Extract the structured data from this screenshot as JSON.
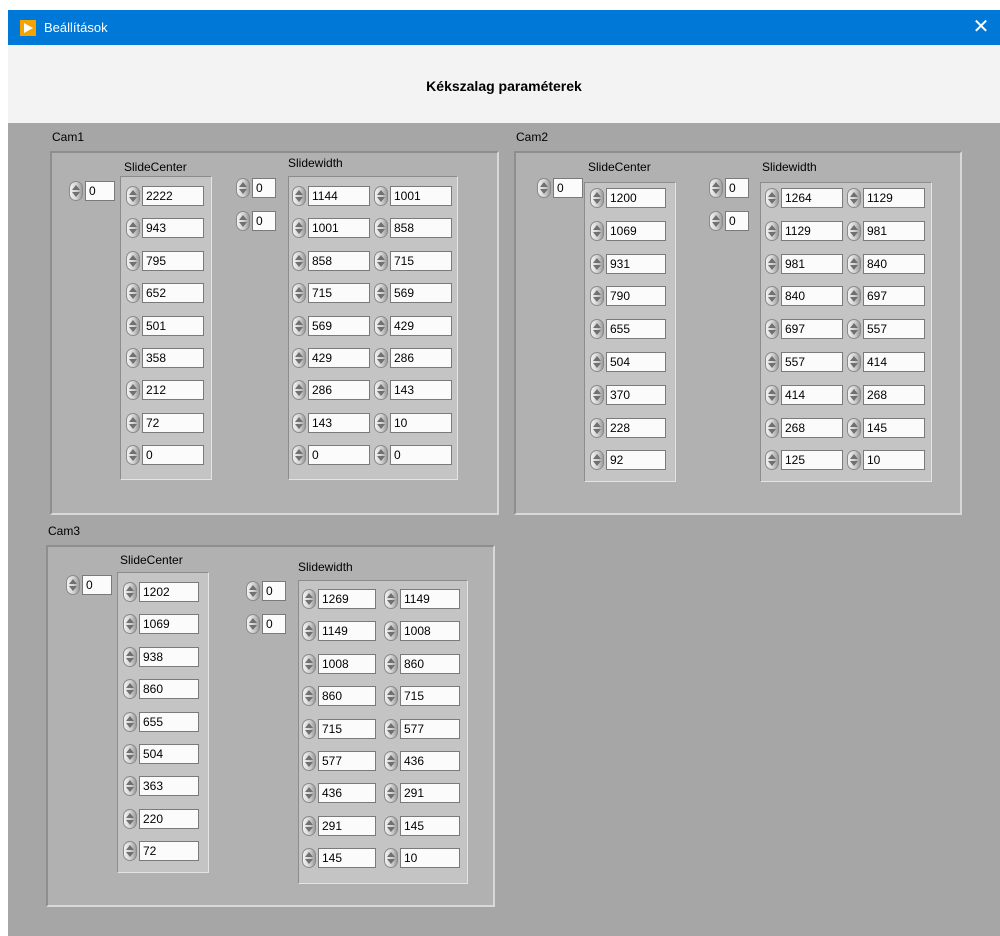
{
  "window": {
    "title": "Beállítások",
    "close_symbol": "✕"
  },
  "page_title": "Kékszalag paraméterek",
  "cams": [
    {
      "label": "Cam1",
      "center_index": "0",
      "center_label": "SlideCenter",
      "center_values": [
        "2222",
        "943",
        "795",
        "652",
        "501",
        "358",
        "212",
        "72",
        "0"
      ],
      "width_label": "Slidewidth",
      "width_index_row": "0",
      "width_index_col": "0",
      "width_col1": [
        "1144",
        "1001",
        "858",
        "715",
        "569",
        "429",
        "286",
        "143",
        "0"
      ],
      "width_col2": [
        "1001",
        "858",
        "715",
        "569",
        "429",
        "286",
        "143",
        "10",
        "0"
      ]
    },
    {
      "label": "Cam2",
      "center_index": "0",
      "center_label": "SlideCenter",
      "center_values": [
        "1200",
        "1069",
        "931",
        "790",
        "655",
        "504",
        "370",
        "228",
        "92"
      ],
      "width_label": "Slidewidth",
      "width_index_row": "0",
      "width_index_col": "0",
      "width_col1": [
        "1264",
        "1129",
        "981",
        "840",
        "697",
        "557",
        "414",
        "268",
        "125"
      ],
      "width_col2": [
        "1129",
        "981",
        "840",
        "697",
        "557",
        "414",
        "268",
        "145",
        "10"
      ]
    },
    {
      "label": "Cam3",
      "center_index": "0",
      "center_label": "SlideCenter",
      "center_values": [
        "1202",
        "1069",
        "938",
        "860",
        "655",
        "504",
        "363",
        "220",
        "72"
      ],
      "width_label": "Slidewidth",
      "width_index_row": "0",
      "width_index_col": "0",
      "width_col1": [
        "1269",
        "1149",
        "1008",
        "860",
        "715",
        "577",
        "436",
        "291",
        "145"
      ],
      "width_col2": [
        "1149",
        "1008",
        "860",
        "715",
        "577",
        "436",
        "291",
        "145",
        "10"
      ]
    }
  ]
}
